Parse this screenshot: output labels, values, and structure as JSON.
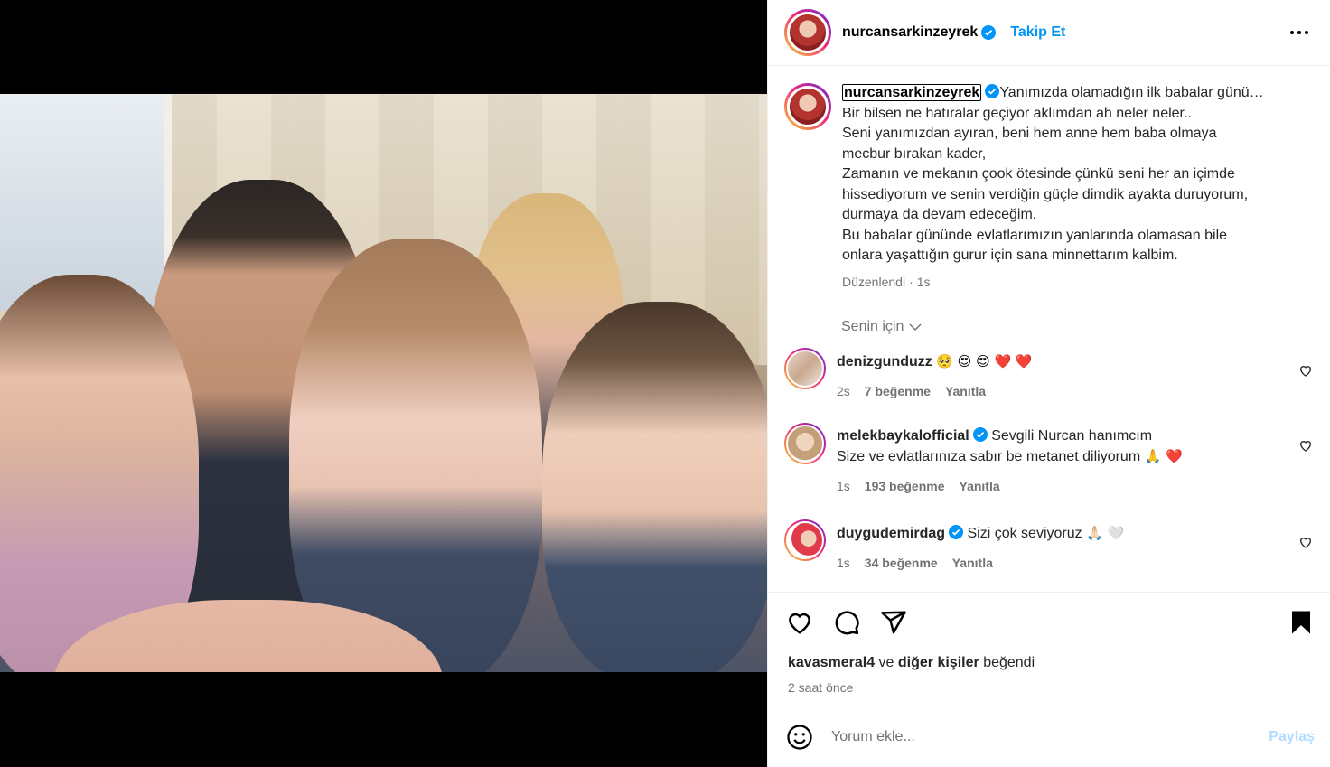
{
  "post": {
    "author": "nurcansarkinzeyrek",
    "follow_label": "Takip Et",
    "caption_lines": [
      "Yanımızda olamadığın ilk babalar günü…",
      "Bir bilsen ne hatıralar geçiyor aklımdan ah neler neler..",
      "Seni yanımızdan ayıran, beni hem anne hem baba olmaya",
      "mecbur bırakan kader,",
      "Zamanın ve mekanın çook ötesinde çünkü seni her an içimde",
      "hissediyorum ve senin verdiğin güçle dimdik ayakta duruyorum,",
      "durmaya da devam edeceğim.",
      "Bu babalar gününde evlatlarımızın yanlarında olamasan bile",
      "onlara yaşattığın gurur için sana minnettarım kalbim."
    ],
    "edited_label": "Düzenlendi",
    "edited_time": "1s"
  },
  "filter_label": "Senin için",
  "comments": [
    {
      "user": "denizgunduzz",
      "verified": false,
      "text": "",
      "emojis": "🥺 😍 😍 ❤️ ❤️",
      "time": "2s",
      "likes": "7 beğenme",
      "reply": "Yanıtla"
    },
    {
      "user": "melekbaykalofficial",
      "verified": true,
      "text": "Sevgili Nurcan hanımcım",
      "text2": "Size ve evlatlarınıza sabır be metanet diliyorum",
      "emojis": "🙏 ❤️",
      "time": "1s",
      "likes": "193 beğenme",
      "reply": "Yanıtla"
    },
    {
      "user": "duygudemirdag",
      "verified": true,
      "text": "Sizi çok seviyoruz",
      "emojis": "🙏🏻 🤍",
      "time": "1s",
      "likes": "34 beğenme",
      "reply": "Yanıtla"
    }
  ],
  "likes": {
    "user": "kavasmeral4",
    "joiner": "ve",
    "others": "diğer kişiler",
    "suffix": "beğendi"
  },
  "posted_ago": "2 saat önce",
  "comment_input": {
    "placeholder": "Yorum ekle...",
    "share_label": "Paylaş"
  },
  "colors": {
    "link": "#0095f6",
    "share_disabled": "#b3dbff",
    "secondary_text": "#737373"
  },
  "icons": [
    "more-icon",
    "verified-icon",
    "chevron-down-icon",
    "heart-icon",
    "comment-icon",
    "share-icon",
    "bookmark-icon",
    "smiley-icon"
  ]
}
